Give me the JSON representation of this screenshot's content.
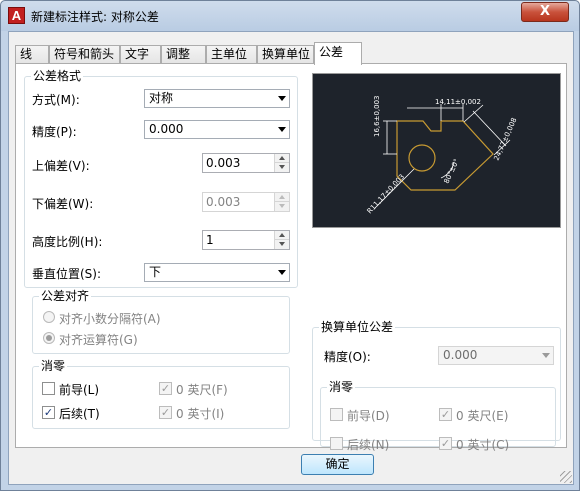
{
  "window": {
    "title": "新建标注样式: 对称公差",
    "app_icon": "A",
    "close_glyph": "X"
  },
  "tabs": [
    {
      "label": "线",
      "active": false
    },
    {
      "label": "符号和箭头",
      "active": false
    },
    {
      "label": "文字",
      "active": false
    },
    {
      "label": "调整",
      "active": false
    },
    {
      "label": "主单位",
      "active": false
    },
    {
      "label": "换算单位",
      "active": false
    },
    {
      "label": "公差",
      "active": true
    }
  ],
  "tolerance_format": {
    "group_title": "公差格式",
    "method_label": "方式(M):",
    "method_value": "对称",
    "precision_label": "精度(P):",
    "precision_value": "0.000",
    "upper_label": "上偏差(V):",
    "upper_value": "0.003",
    "lower_label": "下偏差(W):",
    "lower_value": "0.003",
    "height_label": "高度比例(H):",
    "height_value": "1",
    "vertical_label": "垂直位置(S):",
    "vertical_value": "下"
  },
  "tolerance_alignment": {
    "group_title": "公差对齐",
    "option_decimal": "对齐小数分隔符(A)",
    "option_operator": "对齐运算符(G)",
    "selected": "option_operator"
  },
  "zero_suppression": {
    "group_title": "消零",
    "leading_label": "前导(L)",
    "leading_checked": false,
    "trailing_label": "后续(T)",
    "trailing_checked": true,
    "feet_label": "0 英尺(F)",
    "feet_checked": true,
    "inches_label": "0 英寸(I)",
    "inches_checked": true
  },
  "preview": {
    "dim_top": "14,11±0,002",
    "dim_left": "16,6±0,003",
    "dim_right": "24,77±0,008",
    "dim_angle": "80°±0°",
    "dim_radius": "R11,17±0,003",
    "line_color": "#ffffff",
    "part_color": "#c79a32",
    "background": "#1e232b"
  },
  "alt_unit_tolerance": {
    "group_title": "换算单位公差",
    "precision_label": "精度(O):",
    "precision_value": "0.000",
    "zero_title": "消零",
    "leading_label": "前导(D)",
    "leading_checked": false,
    "trailing_label": "后续(N)",
    "trailing_checked": false,
    "feet_label": "0 英尺(E)",
    "feet_checked": true,
    "inches_label": "0 英寸(C)",
    "inches_checked": true
  },
  "buttons": {
    "ok": "确定"
  }
}
